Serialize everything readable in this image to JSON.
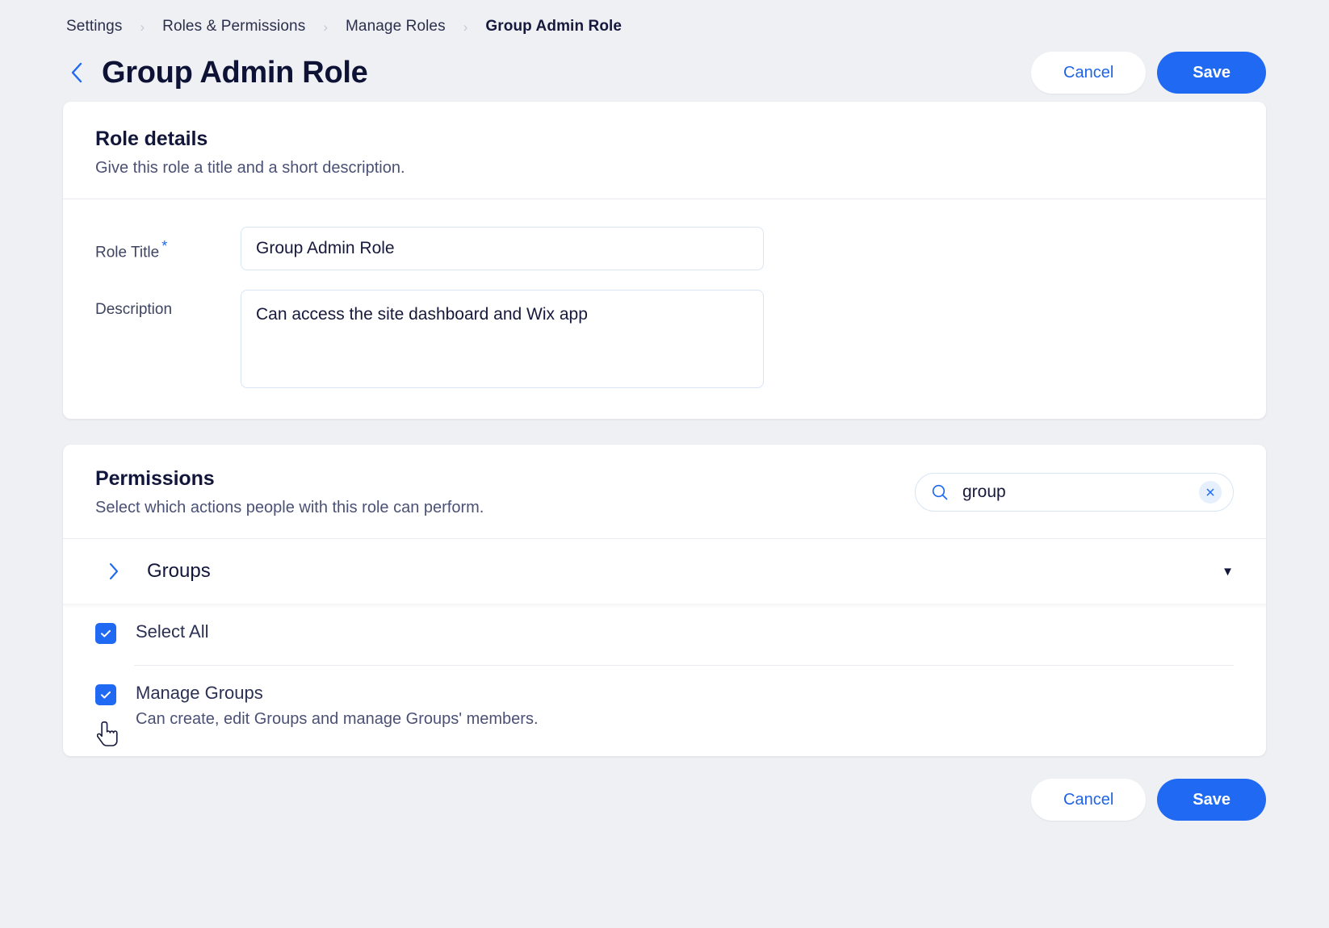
{
  "breadcrumb": {
    "items": [
      {
        "label": "Settings"
      },
      {
        "label": "Roles & Permissions"
      },
      {
        "label": "Manage Roles"
      },
      {
        "label": "Group Admin Role"
      }
    ],
    "separator": "›"
  },
  "header": {
    "back_icon": "chevron-left-icon",
    "title": "Group Admin Role",
    "cancel_label": "Cancel",
    "save_label": "Save"
  },
  "role_details": {
    "title": "Role details",
    "subtitle": "Give this role a title and a short description.",
    "role_title_label": "Role Title",
    "required_mark": "*",
    "role_title_value": "Group Admin Role",
    "role_title_placeholder": "Enter a role title",
    "description_label": "Description",
    "description_value": "Can access the site dashboard and Wix app",
    "description_placeholder": "Describe this role"
  },
  "permissions": {
    "title": "Permissions",
    "subtitle": "Select which actions people with this role can perform.",
    "search": {
      "icon": "search-icon",
      "value": "group",
      "placeholder": "Search permissions",
      "clear_icon": "close-icon"
    },
    "group": {
      "expand_icon": "chevron-right-icon",
      "name": "Groups",
      "caret": "▼"
    },
    "items": [
      {
        "label": "Select All",
        "description": "",
        "checked": true
      },
      {
        "label": "Manage Groups",
        "description": "Can create, edit Groups and manage Groups' members.",
        "checked": true
      }
    ]
  },
  "footer": {
    "cancel_label": "Cancel",
    "save_label": "Save"
  },
  "colors": {
    "accent": "#2069f3",
    "link": "#1f64e6",
    "title": "#0e1234",
    "page_bg": "#eef0f4"
  }
}
